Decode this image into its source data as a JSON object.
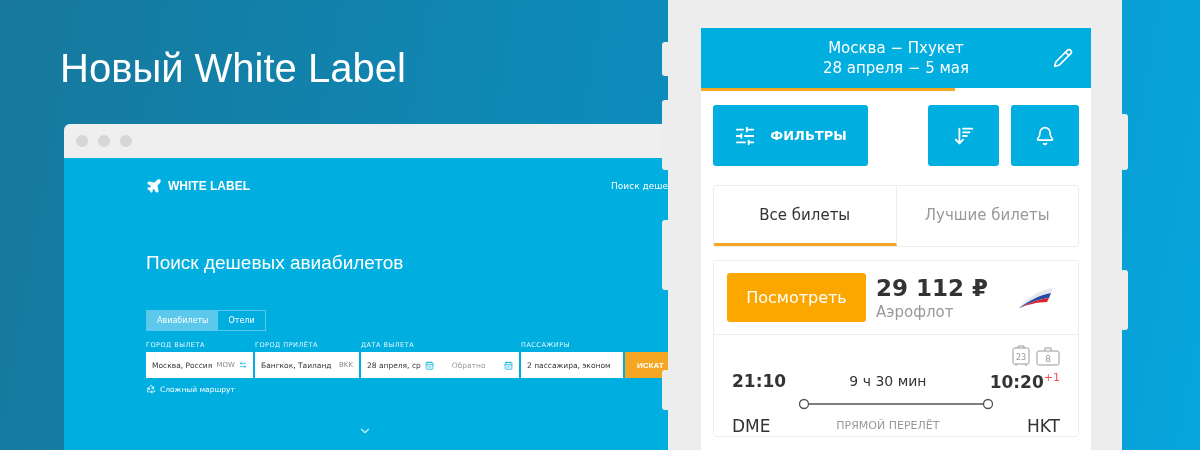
{
  "headline": "Новый White Label",
  "browser": {
    "logo": "WHITE LABEL",
    "nav_link": "Поиск деше",
    "heading": "Поиск дешевых авиабилетов",
    "tabs": [
      {
        "label": "Авиабилеты",
        "selected": true
      },
      {
        "label": "Отели",
        "selected": false
      }
    ],
    "fields": [
      {
        "kind": "city",
        "label": "ГОРОД ВЫЛЕТА",
        "value": "Москва, Россия",
        "code": "MOW"
      },
      {
        "kind": "city",
        "label": "ГОРОД ПРИЛЁТА",
        "value": "Бангкок, Таиланд",
        "code": "BKK"
      },
      {
        "kind": "dates",
        "label": "ДАТА ВЫЛЕТА",
        "value": "28 апреля, ср",
        "placeholder": "Обратно"
      },
      {
        "kind": "select",
        "label": "ПАССАЖИРЫ",
        "value": "2 пассажира, эконом"
      }
    ],
    "search_button": "ИСКАТ",
    "complex_route": "Сложный маршрут"
  },
  "phone": {
    "route": "Москва − Пхукет",
    "dates": "28 апреля − 5 мая",
    "loading": {
      "level": 0.65
    },
    "filters_button": "ФИЛЬТРЫ",
    "tabs": [
      {
        "label": "Все билеты",
        "selected": true
      },
      {
        "label": "Лучшие билеты",
        "selected": false
      }
    ],
    "ticket": {
      "button": "Посмотреть",
      "price": "29 112 ₽",
      "airline": "Аэрофлот",
      "baggage": "23",
      "hand_luggage": "8",
      "depart_time": "21:10",
      "duration": "9 ч 30 мин",
      "arrive_time": "10:20",
      "day_offset": "+1",
      "from": "DME",
      "flight_type": "ПРЯМОЙ ПЕРЕЛЁТ",
      "to": "HKT"
    }
  }
}
